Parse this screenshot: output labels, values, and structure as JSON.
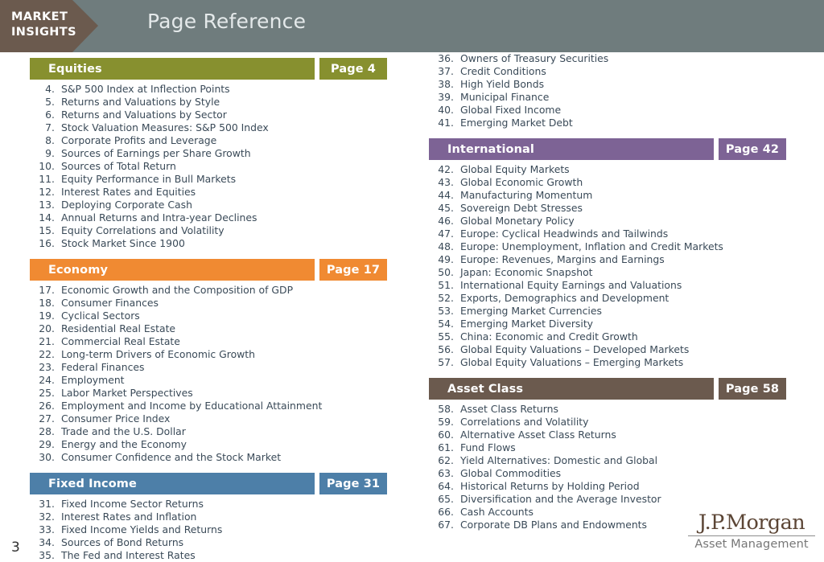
{
  "header": {
    "brand_line_1": "MARKET",
    "brand_line_2": "INSIGHTS",
    "title": "Page Reference",
    "background_color": "#6f7c7d",
    "brand_tab_color": "#6b5a4e"
  },
  "page_number": "3",
  "logo": {
    "main": "J.P.Morgan",
    "sub": "Asset Management"
  },
  "columns": {
    "left": [
      {
        "name": "Equities",
        "page_label": "Page 4",
        "color": "#87902f",
        "items": [
          {
            "num": "4.",
            "text": "S&P 500 Index at Inflection Points"
          },
          {
            "num": "5.",
            "text": "Returns and Valuations by Style"
          },
          {
            "num": "6.",
            "text": "Returns and Valuations by Sector"
          },
          {
            "num": "7.",
            "text": "Stock Valuation Measures: S&P 500 Index"
          },
          {
            "num": "8.",
            "text": "Corporate Profits and Leverage"
          },
          {
            "num": "9.",
            "text": "Sources of Earnings per Share Growth"
          },
          {
            "num": "10.",
            "text": "Sources of Total Return"
          },
          {
            "num": "11.",
            "text": "Equity Performance in Bull Markets"
          },
          {
            "num": "12.",
            "text": "Interest Rates and Equities"
          },
          {
            "num": "13.",
            "text": "Deploying Corporate Cash"
          },
          {
            "num": "14.",
            "text": "Annual Returns and Intra-year Declines"
          },
          {
            "num": "15.",
            "text": "Equity Correlations and Volatility"
          },
          {
            "num": "16.",
            "text": "Stock Market Since 1900"
          }
        ]
      },
      {
        "name": "Economy",
        "page_label": "Page 17",
        "color": "#f08a32",
        "items": [
          {
            "num": "17.",
            "text": "Economic Growth and the Composition of GDP"
          },
          {
            "num": "18.",
            "text": "Consumer Finances"
          },
          {
            "num": "19.",
            "text": "Cyclical Sectors"
          },
          {
            "num": "20.",
            "text": "Residential Real Estate"
          },
          {
            "num": "21.",
            "text": "Commercial Real Estate"
          },
          {
            "num": "22.",
            "text": "Long-term Drivers of Economic Growth"
          },
          {
            "num": "23.",
            "text": "Federal Finances"
          },
          {
            "num": "24.",
            "text": "Employment"
          },
          {
            "num": "25.",
            "text": "Labor Market Perspectives"
          },
          {
            "num": "26.",
            "text": "Employment and Income by Educational Attainment"
          },
          {
            "num": "27.",
            "text": "Consumer Price Index"
          },
          {
            "num": "28.",
            "text": "Trade and the U.S. Dollar"
          },
          {
            "num": "29.",
            "text": "Energy and the Economy"
          },
          {
            "num": "30.",
            "text": "Consumer Confidence and the Stock Market"
          }
        ]
      },
      {
        "name": "Fixed Income",
        "page_label": "Page 31",
        "color": "#4d7fa8",
        "items": [
          {
            "num": "31.",
            "text": "Fixed Income Sector Returns"
          },
          {
            "num": "32.",
            "text": "Interest Rates and Inflation"
          },
          {
            "num": "33.",
            "text": "Fixed Income Yields and Returns"
          },
          {
            "num": "34.",
            "text": "Sources of Bond Returns"
          },
          {
            "num": "35.",
            "text": "The Fed and Interest Rates"
          }
        ]
      }
    ],
    "right": [
      {
        "name": "",
        "page_label": "",
        "color": "",
        "items": [
          {
            "num": "36.",
            "text": "Owners of Treasury Securities"
          },
          {
            "num": "37.",
            "text": "Credit Conditions"
          },
          {
            "num": "38.",
            "text": "High Yield Bonds"
          },
          {
            "num": "39.",
            "text": "Municipal Finance"
          },
          {
            "num": "40.",
            "text": "Global Fixed Income"
          },
          {
            "num": "41.",
            "text": "Emerging Market Debt"
          }
        ]
      },
      {
        "name": "International",
        "page_label": "Page 42",
        "color": "#7d6395",
        "items": [
          {
            "num": "42.",
            "text": "Global Equity Markets"
          },
          {
            "num": "43.",
            "text": "Global Economic Growth"
          },
          {
            "num": "44.",
            "text": "Manufacturing Momentum"
          },
          {
            "num": "45.",
            "text": "Sovereign Debt Stresses"
          },
          {
            "num": "46.",
            "text": "Global Monetary Policy"
          },
          {
            "num": "47.",
            "text": "Europe: Cyclical Headwinds and Tailwinds"
          },
          {
            "num": "48.",
            "text": "Europe: Unemployment, Inflation and Credit Markets"
          },
          {
            "num": "49.",
            "text": "Europe: Revenues, Margins and Earnings"
          },
          {
            "num": "50.",
            "text": "Japan: Economic Snapshot"
          },
          {
            "num": "51.",
            "text": "International Equity Earnings and Valuations"
          },
          {
            "num": "52.",
            "text": "Exports, Demographics and Development"
          },
          {
            "num": "53.",
            "text": "Emerging Market Currencies"
          },
          {
            "num": "54.",
            "text": "Emerging Market Diversity"
          },
          {
            "num": "55.",
            "text": "China: Economic and Credit Growth"
          },
          {
            "num": "56.",
            "text": "Global Equity Valuations – Developed Markets"
          },
          {
            "num": "57.",
            "text": "Global Equity Valuations – Emerging Markets"
          }
        ]
      },
      {
        "name": "Asset Class",
        "page_label": "Page 58",
        "color": "#6b5a4e",
        "items": [
          {
            "num": "58.",
            "text": "Asset Class Returns"
          },
          {
            "num": "59.",
            "text": "Correlations and Volatility"
          },
          {
            "num": "60.",
            "text": "Alternative Asset Class Returns"
          },
          {
            "num": "61.",
            "text": "Fund Flows"
          },
          {
            "num": "62.",
            "text": "Yield Alternatives: Domestic and Global"
          },
          {
            "num": "63.",
            "text": "Global Commodities"
          },
          {
            "num": "64.",
            "text": "Historical Returns by Holding Period"
          },
          {
            "num": "65.",
            "text": "Diversification and the Average Investor"
          },
          {
            "num": "66.",
            "text": "Cash Accounts"
          },
          {
            "num": "67.",
            "text": "Corporate DB Plans and Endowments"
          }
        ]
      }
    ]
  }
}
